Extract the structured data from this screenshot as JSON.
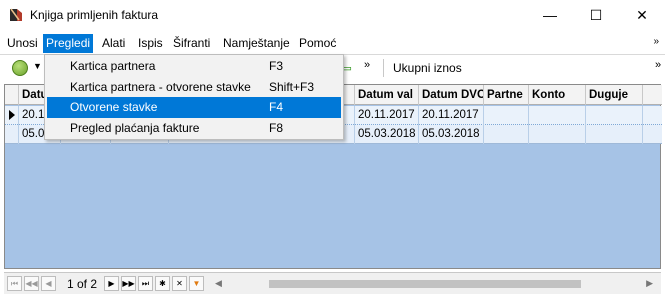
{
  "window": {
    "title": "Knjiga primljenih faktura",
    "minimize_glyph": "—",
    "maximize_glyph": "☐",
    "close_glyph": "✕"
  },
  "menubar": {
    "items": [
      {
        "label": "Unosi",
        "active": false
      },
      {
        "label": "Pregledi",
        "active": true
      },
      {
        "label": "Alati",
        "active": false
      },
      {
        "label": "Ispis",
        "active": false
      },
      {
        "label": "Šifranti",
        "active": false
      },
      {
        "label": "Namještanje",
        "active": false
      },
      {
        "label": "Pomoć",
        "active": false
      }
    ],
    "overflow_glyph": "»"
  },
  "toolbar": {
    "refresh_icon": "refresh-icon",
    "chevron": "»",
    "total_label": "Ukupni iznos"
  },
  "dropdown": {
    "items": [
      {
        "label": "Kartica partnera",
        "shortcut": "F3",
        "highlighted": false
      },
      {
        "label": "Kartica partnera - otvorene stavke",
        "shortcut": "Shift+F3",
        "highlighted": false
      },
      {
        "label": "Otvorene stavke",
        "shortcut": "F4",
        "highlighted": true
      },
      {
        "label": "Pregled plaćanja fakture",
        "shortcut": "F8",
        "highlighted": false
      }
    ]
  },
  "grid": {
    "columns": [
      "Datu",
      "",
      "",
      "",
      "Datum val",
      "Datum DVC",
      "Partne",
      "Konto",
      "Duguje",
      ""
    ],
    "rows": [
      [
        "20.1",
        "",
        "",
        "",
        "20.11.2017",
        "20.11.2017",
        "",
        "",
        "",
        ""
      ],
      [
        "05.03",
        "",
        "",
        "",
        "05.03.2018",
        "05.03.2018",
        "",
        "",
        "",
        ""
      ]
    ]
  },
  "navigator": {
    "page": "1 of 2",
    "colors": {
      "filter": "#e07a10"
    }
  },
  "colors": {
    "accent": "#0078d7",
    "grid_background": "#a6c3e6"
  }
}
